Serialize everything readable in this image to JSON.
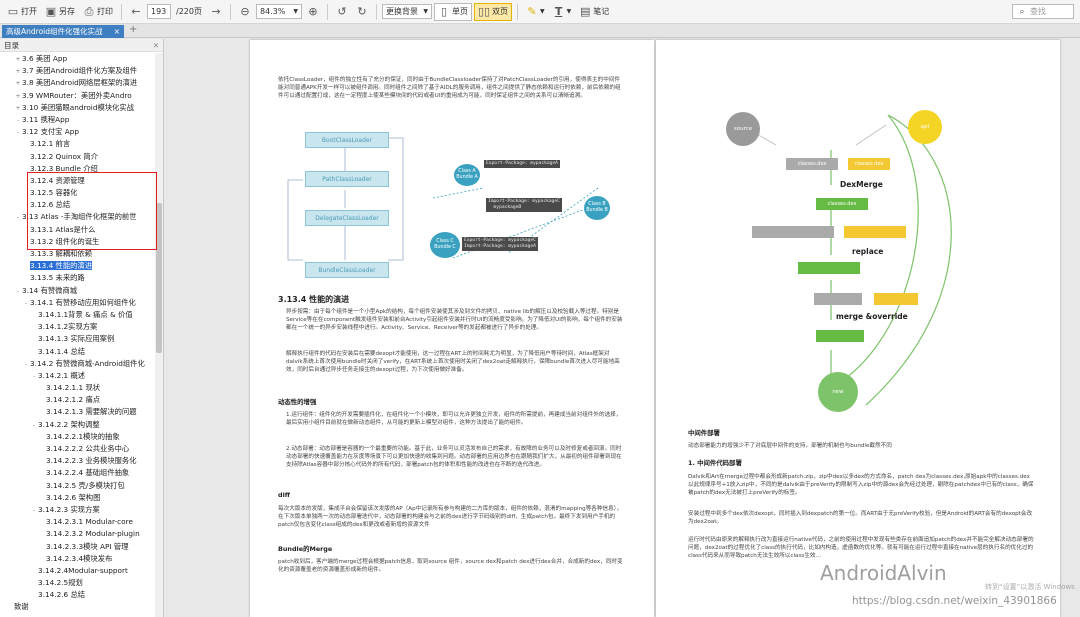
{
  "toolbar": {
    "open": "打开",
    "save_as": "另存",
    "print": "打印",
    "page_current": "193",
    "page_total": "/220页",
    "zoom": "84.3%",
    "background": "更换背景",
    "single_page": "单页",
    "double_page": "双页",
    "notes": "笔记",
    "search_placeholder": "查找"
  },
  "tab": {
    "title": "高级Android组件化强化实战",
    "close": "×",
    "add": "+"
  },
  "sidebar": {
    "title": "目录",
    "items": [
      {
        "indent": 1,
        "toggle": "+",
        "label": "3.6 美团 App"
      },
      {
        "indent": 1,
        "toggle": "+",
        "label": "3.7 美团Android组件化方案及组件"
      },
      {
        "indent": 1,
        "toggle": "+",
        "label": "3.8 美团Android网络层框架的演进"
      },
      {
        "indent": 1,
        "toggle": "+",
        "label": "3.9 WMRouter：美团外卖Andro"
      },
      {
        "indent": 1,
        "toggle": "+",
        "label": "3.10 美团猫眼android模块化实战"
      },
      {
        "indent": 1,
        "toggle": "-",
        "label": "3.11 携程App"
      },
      {
        "indent": 1,
        "toggle": "-",
        "label": "3.12 支付宝 App"
      },
      {
        "indent": 2,
        "toggle": "",
        "label": "3.12.1 前言"
      },
      {
        "indent": 2,
        "toggle": "",
        "label": "3.12.2 Quinox 简介"
      },
      {
        "indent": 2,
        "toggle": "",
        "label": "3.12.3 Bundle 介绍"
      },
      {
        "indent": 2,
        "toggle": "",
        "label": "3.12.4 资源管理"
      },
      {
        "indent": 2,
        "toggle": "",
        "label": "3.12.5 容器化"
      },
      {
        "indent": 2,
        "toggle": "",
        "label": "3.12.6 总结"
      },
      {
        "indent": 1,
        "toggle": "-",
        "label": "3.13 Atlas -手淘组件化框架的前世"
      },
      {
        "indent": 2,
        "toggle": "",
        "label": "3.13.1 Atlas是什么"
      },
      {
        "indent": 2,
        "toggle": "",
        "label": "3.13.2 组件化的诞生"
      },
      {
        "indent": 2,
        "toggle": "",
        "label": "3.13.3 解耦和依赖"
      },
      {
        "indent": 2,
        "toggle": "",
        "label": "3.13.4 性能的演进",
        "selected": true
      },
      {
        "indent": 2,
        "toggle": "",
        "label": "3.13.5 未来的路"
      },
      {
        "indent": 1,
        "toggle": "-",
        "label": "3.14 有赞微商城"
      },
      {
        "indent": 2,
        "toggle": "-",
        "label": "3.14.1 有赞移动应用如何组件化"
      },
      {
        "indent": 3,
        "toggle": "",
        "label": "3.14.1.1背景 & 痛点 & 价值"
      },
      {
        "indent": 3,
        "toggle": "",
        "label": "3.14.1.2实现方案"
      },
      {
        "indent": 3,
        "toggle": "",
        "label": "3.14.1.3 实际应用案例"
      },
      {
        "indent": 3,
        "toggle": "",
        "label": "3.14.1.4 总结"
      },
      {
        "indent": 2,
        "toggle": "-",
        "label": "3.14.2 有赞微商城-Android组件化"
      },
      {
        "indent": 3,
        "toggle": "-",
        "label": "3.14.2.1 概述"
      },
      {
        "indent": 4,
        "toggle": "",
        "label": "3.14.2.1.1 现状"
      },
      {
        "indent": 4,
        "toggle": "",
        "label": "3.14.2.1.2 痛点"
      },
      {
        "indent": 4,
        "toggle": "",
        "label": "3.14.2.1.3 需要解决的问题"
      },
      {
        "indent": 3,
        "toggle": "-",
        "label": "3.14.2.2 架构调整"
      },
      {
        "indent": 4,
        "toggle": "",
        "label": "3.14.2.2.1模块的抽象"
      },
      {
        "indent": 4,
        "toggle": "",
        "label": "3.14.2.2.2 公共业务中心"
      },
      {
        "indent": 4,
        "toggle": "",
        "label": "3.14.2.2.3 业务模块服务化"
      },
      {
        "indent": 4,
        "toggle": "",
        "label": "3.14.2.2.4 基础组件抽象"
      },
      {
        "indent": 4,
        "toggle": "",
        "label": "3.14.2.5 壳/多模块打包"
      },
      {
        "indent": 4,
        "toggle": "",
        "label": "3.14.2.6 架构图"
      },
      {
        "indent": 3,
        "toggle": "-",
        "label": "3.14.2.3 实现方案"
      },
      {
        "indent": 4,
        "toggle": "",
        "label": "3.14.2.3.1 Modular-core"
      },
      {
        "indent": 4,
        "toggle": "",
        "label": "3.14.2.3.2 Modular-plugin"
      },
      {
        "indent": 4,
        "toggle": "",
        "label": "3.14.2.3.3模块 API 管理"
      },
      {
        "indent": 4,
        "toggle": "",
        "label": "3.14.2.3.4模块发布"
      },
      {
        "indent": 3,
        "toggle": "",
        "label": "3.14.2.4Modular-support"
      },
      {
        "indent": 3,
        "toggle": "",
        "label": "3.14.2.5规划"
      },
      {
        "indent": 3,
        "toggle": "",
        "label": "3.14.2.6 总结"
      },
      {
        "indent": 0,
        "toggle": "",
        "label": "致谢"
      }
    ]
  },
  "page_left": {
    "para1": "依托ClassLoader，组件的独立性有了充分的保证，同时由于BundleClassloader保持了对PatchClassLoader的引用，使得表主的中间件能对同普通APK开发一样可以被组件调用。同时组件之间除了基于AIDL的服务调用，组件之间提供了静态依赖和运行时依赖，前后依赖的组件可以通过配置打成，这在一定程度上使某些模块间的代码或者UI的重用成为可能，同时保证组件之间的关系可以清晰追溯。",
    "class_loaders": [
      "BootClassLoader",
      "PathClassLoader",
      "DelegateClassLoader",
      "BundleClassLoader"
    ],
    "bundles": [
      "Class A\nBundle A",
      "Class B\nBundle B",
      "Class C\nBundle C"
    ],
    "pkgs": [
      "Export-Package: mypackageA",
      "Import-Package: mypackageC\n  mypackageB",
      "Export-Package: mypackageC\nImport-Package: mypackageA"
    ],
    "section_title": "3.13.4 性能的演进",
    "para2": "异步按需：由于每个组件是一个小型Apk的结构，每个组件安装使其涉及到文件的拷贝、native lib的解压以及校验载入等过程。特别是Service等在在component触发组件安装和前台Activity引起组件安装并行时UI的流畅度受影响。为了降低对UI的影响，每个组件的安装都在一个统一的异步安装线程中进行。Activity、Service、Receiver等的发起都被进行了异步的处理。",
    "para3": "解释执行组件的代码在安装后在需要dexopt才能使用，这一过程在ART上的时间耗尤为明显，为了降低用户等待时间，Atlas框架对dalvik系统上首次使用bundle时关闭了verify，在ART系统上首次使用时关闭了dex2oat走解释执行，保障bundle首次进入尽可能地高效，同时后台通过异步任务走接生的dexopt过程，为下次使用做好准备。",
    "sub1": "动态性的增强",
    "para4": "1.运行组件：组件化的开发需要插件化，在组件化一个小模块，即可以允许更独立开发，组件的所需提前，再建成当前对组件外的选择，最后实用小组件目前就在做新动态组件，从可能的更新上模型对组件，这种方法提出了能的组件。",
    "para5": "2.动态部署：动态部署是容器的一个最重要的功能。基于此，业务可以灵活发布自己的需求，有故障的业务可以及时修复或者回滚。同时动态部署的快速覆盖能力在灰度等场景下可以更加快速的收集到问题。动态部署的应用边界也在跟随我们扩大，从最初的组件部署到现在支持除Atlas容器中部分核心代码外的所有代码，部署patch包的体积和性能的改进也在不断的迭代改进。",
    "sub2": "diff",
    "para6": "每次大版本的发版，集成平台会保留该次发版的AP（Ap中记录所有参与构建的二方库的版本，组件的依赖，混淆的mapping等各种信息），在下次版本单独两一次的动态部署迭代中，动态部署的构建会与之前的dex进行字节码级别的diff，生成patch包，最终下发到用户手机的patch仅包含变化class组成的dex和更改或者新增的资源文件",
    "sub3": "Bundle的Merge",
    "para7": "patch收到后，客户端的merge过程会根据patch信息，取到source 组件，source dex和patch dex进行dex合并，合成新的dex，同时变化的资源覆盖老的资源覆盖形成新的组件。"
  },
  "page_right": {
    "dex": {
      "source": "source",
      "apt": "apt",
      "classes_dex_gray": "classes.dex",
      "classes_dex_yellow": "classes.dex",
      "classes_dex_green": "classes.dex",
      "dexmerge": "DexMerge",
      "replace": "replace",
      "merge_override": "merge &override",
      "new": "new"
    },
    "sub1": "中间件部署",
    "para1": "动态部署能力的增强少不了对底层中间件的支持，部署的机制也与bundle截然不同",
    "sub2": "1. 中间件代码部署",
    "para2": "Dalvik和Art在merge过程中都会形成新patch.zip，zip中dex以多dex的方式命名，patch dex为classes.dex,原始apk中的classes.dex以此规律序号+1放入zip中，不同的是dalvik由于preVerify的限制写入zip中的源dex会先经过处理，剔除在patchdex中已有的class，确保被patch的dex无法被打上preVerify的标签。",
    "para3": "安装过程中到多个dex依次dexopt，同时插入到dexpatch的第一位。而ART由于无preVerify校验，但是Android的ART会有的dexopt会改为dex2oat。",
    "para4": "运行时代码由原来的解释执行改为直接运行native代码，之前的使用过程中发现有些类存在前面追加patch的dex并不能完全解决动态部署的问题，dex2oat的过程优化了class的执行代码，比如内构造，虚函数的优化等。就有可能在运行过程中直接在native层的执行名的优化过的class代码来从而导致patch无法生效所以class生效…"
  },
  "watermark": {
    "brand": "AndroidAlvin",
    "url": "https://blog.csdn.net/weixin_43901866",
    "activate": "转到“设置”以激活 Windows"
  }
}
